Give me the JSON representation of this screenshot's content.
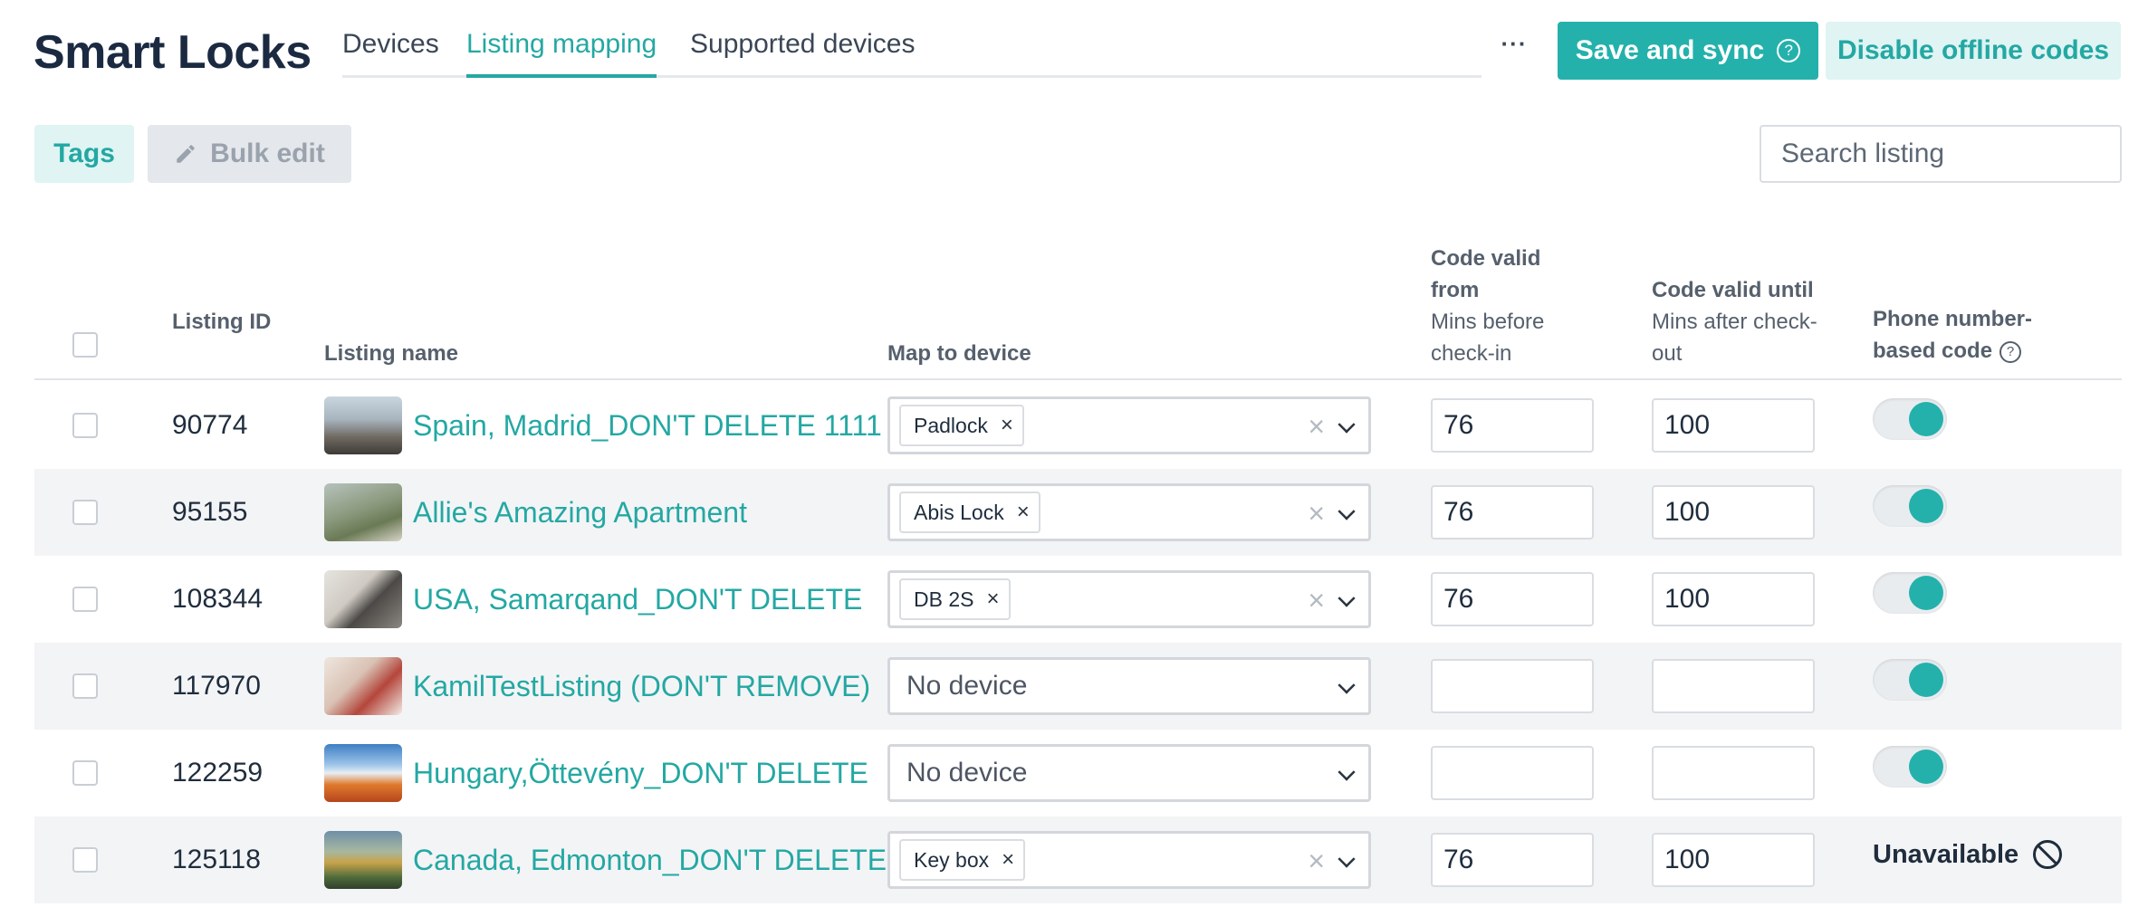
{
  "app": {
    "title": "Smart Locks"
  },
  "tabs": [
    {
      "label": "Devices",
      "active": false
    },
    {
      "label": "Listing mapping",
      "active": true
    },
    {
      "label": "Supported devices",
      "active": false
    }
  ],
  "header": {
    "more_label": "···",
    "save_label": "Save and sync",
    "save_help": "?",
    "disable_label": "Disable offline codes"
  },
  "toolbar": {
    "tags_label": "Tags",
    "bulk_label": "Bulk edit",
    "search_placeholder": "Search listing"
  },
  "table": {
    "columns": {
      "id": "Listing ID",
      "name": "Listing name",
      "map": "Map to device",
      "from": "Code valid from",
      "from_sub": "Mins before check-in",
      "until": "Code valid until",
      "until_sub": "Mins after check-out",
      "phone": "Phone number-based code",
      "phone_help": "?"
    },
    "rows": [
      {
        "id": "90774",
        "name": "Spain, Madrid_DON'T DELETE 1111",
        "device": "Padlock",
        "from": "76",
        "until": "100",
        "phone": "on"
      },
      {
        "id": "95155",
        "name": "Allie's Amazing Apartment",
        "device": "Abis Lock",
        "from": "76",
        "until": "100",
        "phone": "on"
      },
      {
        "id": "108344",
        "name": "USA, Samarqand_DON'T DELETE",
        "device": "DB 2S",
        "from": "76",
        "until": "100",
        "phone": "on"
      },
      {
        "id": "117970",
        "name": "KamilTestListing (DON'T REMOVE)",
        "device": "No device",
        "from": "",
        "until": "",
        "phone": "on"
      },
      {
        "id": "122259",
        "name": "Hungary,Öttevény_DON'T DELETE",
        "device": "No device",
        "from": "",
        "until": "",
        "phone": "on"
      },
      {
        "id": "125118",
        "name": "Canada, Edmonton_DON'T DELETE",
        "device": "Key box",
        "from": "76",
        "until": "100",
        "phone": "Unavailable"
      }
    ]
  },
  "colors": {
    "accent": "#24b1ac",
    "accent_light": "#dff4f3",
    "text": "#1b2a41"
  }
}
